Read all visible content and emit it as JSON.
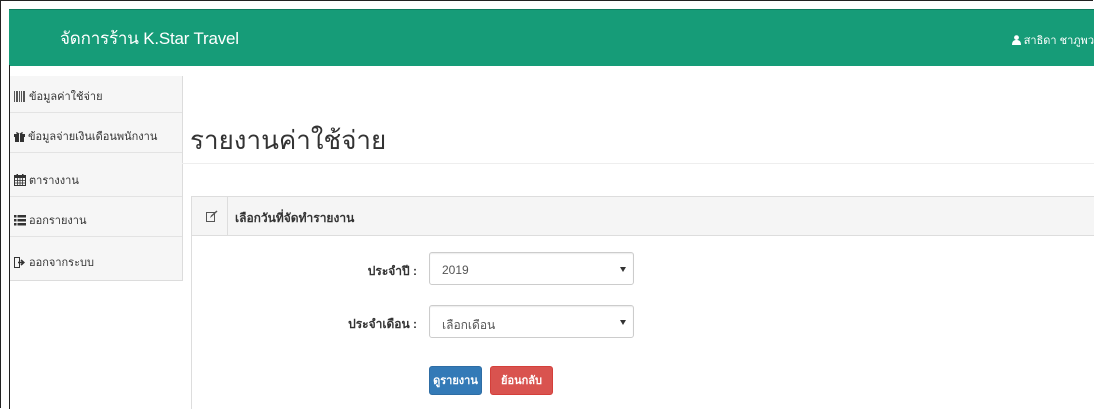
{
  "navbar": {
    "brand": "จัดการร้าน K.Star Travel",
    "user_name": "สาธิดา ชาภูพว"
  },
  "sidebar": {
    "items": [
      {
        "label": "ข้อมูลค่าใช้จ่าย",
        "icon": "barcode-icon"
      },
      {
        "label": "ข้อมูลจ่ายเงินเดือนพนักงาน",
        "icon": "gift-icon"
      },
      {
        "label": "ตารางงาน",
        "icon": "calendar-icon"
      },
      {
        "label": "ออกรายงาน",
        "icon": "list-icon"
      },
      {
        "label": "ออกจากระบบ",
        "icon": "log-out-icon"
      }
    ]
  },
  "main": {
    "title": "รายงานค่าใช้จ่าย",
    "panel_heading": "เลือกวันที่จัดทำรายงาน",
    "year_label": "ประจำปี :",
    "year_value": "2019",
    "month_label": "ประจำเดือน :",
    "month_value": "เลือกเดือน",
    "report_button": "ดูรายงาน",
    "back_button": "ย้อนกลับ"
  },
  "colors": {
    "navbar": "#169c78",
    "primary_button": "#337ab7",
    "danger_button": "#d9534f"
  }
}
